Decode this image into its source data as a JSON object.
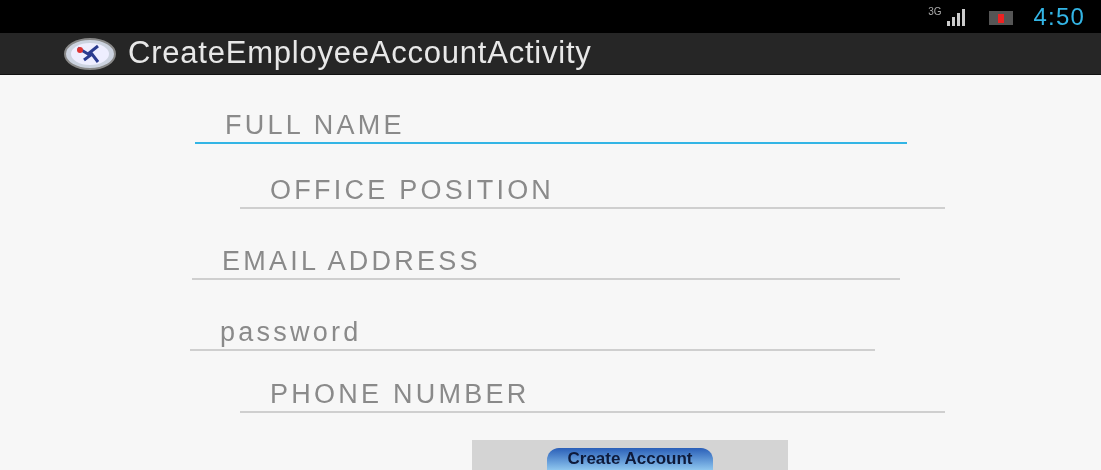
{
  "status_bar": {
    "network": "3G",
    "time": "4:50"
  },
  "action_bar": {
    "title": "CreateEmployeeAccountActivity"
  },
  "fields": [
    {
      "placeholder": "FULL NAME",
      "focused": true
    },
    {
      "placeholder": "OFFICE POSITION",
      "focused": false
    },
    {
      "placeholder": "EMAIL ADDRESS",
      "focused": false
    },
    {
      "placeholder": "password",
      "focused": false
    },
    {
      "placeholder": "PHONE NUMBER",
      "focused": false
    }
  ],
  "button": {
    "label": "Create Account"
  }
}
